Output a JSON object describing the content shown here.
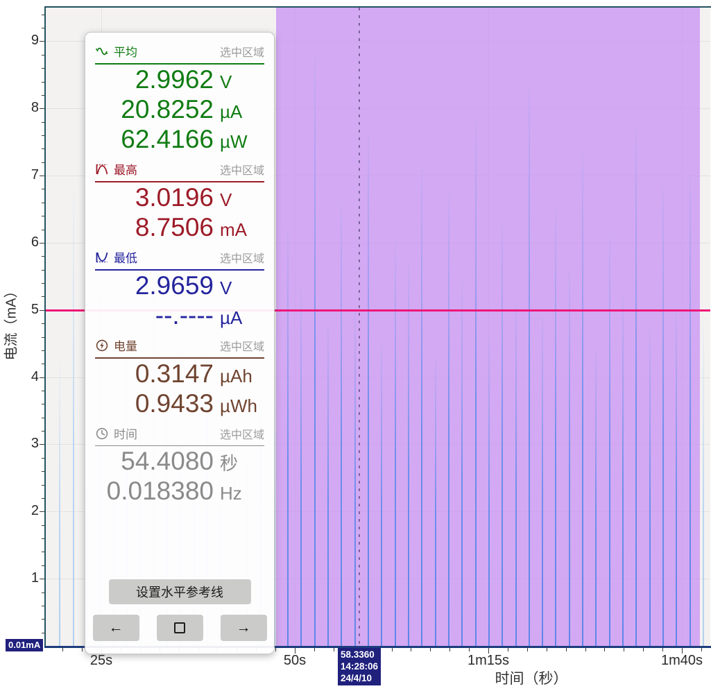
{
  "y_axis": {
    "title": "电流（mA）",
    "unit_marker": "0.01mA",
    "major_ticks": [
      1,
      2,
      3,
      4,
      5,
      6,
      7,
      8,
      9
    ]
  },
  "x_axis": {
    "title": "时间（秒）",
    "major_ticks": [
      {
        "t": 25,
        "label": "25s"
      },
      {
        "t": 50,
        "label": "50s"
      },
      {
        "t": 75,
        "label": "1m15s"
      },
      {
        "t": 100,
        "label": "1m40s"
      }
    ]
  },
  "cursor_badge": {
    "time": "58.3360",
    "clock": "14:28:06",
    "date": "24/4/10"
  },
  "panel": {
    "scope_label": "选中区域",
    "sections": [
      {
        "id": "average",
        "label": "平均",
        "icon": "wave-icon",
        "color": "#107c12",
        "rows": [
          {
            "value": "2.9962",
            "unit": "V"
          },
          {
            "value": "20.8252",
            "unit": "µA"
          },
          {
            "value": "62.4166",
            "unit": "µW"
          }
        ]
      },
      {
        "id": "maximum",
        "label": "最高",
        "icon": "peak-icon",
        "color": "#9c1b28",
        "rows": [
          {
            "value": "3.0196",
            "unit": "V"
          },
          {
            "value": "8.7506",
            "unit": "mA"
          }
        ]
      },
      {
        "id": "minimum",
        "label": "最低",
        "icon": "valley-icon",
        "color": "#24249c",
        "rows": [
          {
            "value": "2.9659",
            "unit": "V"
          },
          {
            "value": "--.----",
            "unit": "µA"
          }
        ]
      },
      {
        "id": "energy",
        "label": "电量",
        "icon": "energy-icon",
        "color": "#6f4430",
        "rows": [
          {
            "value": "0.3147",
            "unit": "µAh"
          },
          {
            "value": "0.9433",
            "unit": "µWh"
          }
        ]
      },
      {
        "id": "time",
        "label": "时间",
        "icon": "clock-icon",
        "color": "#8a8a8a",
        "rows": [
          {
            "value": "54.4080",
            "unit": "秒"
          },
          {
            "value": "0.018380",
            "unit": "Hz"
          }
        ]
      }
    ],
    "set_ref_button": "设置水平参考线",
    "nav_buttons": [
      {
        "id": "prev",
        "glyph": "←"
      },
      {
        "id": "stop",
        "glyph": "square"
      },
      {
        "id": "next",
        "glyph": "→"
      }
    ]
  },
  "colors": {
    "selection": "#d6b3f4",
    "spike_blue": "#6d8eec",
    "spike_light": "#aacdf2",
    "reference_pink": "#ee1677",
    "badge_navy": "#20207d",
    "border_teal": "#235261",
    "axis_navy": "#1d3c7e"
  },
  "chart_data": {
    "type": "line",
    "title": "",
    "xlabel": "时间（秒）",
    "ylabel": "电流（mA）",
    "x_range_s": [
      17.8,
      103.7
    ],
    "y_range_mA": [
      0,
      9.5
    ],
    "x_tick_labels": [
      "25s",
      "50s",
      "1m15s",
      "1m40s"
    ],
    "x_tick_values_s": [
      25,
      50,
      75,
      100
    ],
    "y_tick_values_mA": [
      1,
      2,
      3,
      4,
      5,
      6,
      7,
      8,
      9
    ],
    "minor_x_step_s": 2.5,
    "minor_y_step_mA": 0.2,
    "reference_line_mA": 5,
    "cursor_time_s": 58.336,
    "selection": {
      "start_s": 47.58,
      "end_s": 102.33
    },
    "spikes": {
      "start_s": 17.92,
      "period_s": 1.732,
      "peaks_mA": [
        5.6,
        4.2,
        6.8,
        5.1,
        7.4,
        4.6,
        6.1,
        5.5,
        7.9,
        4.9,
        6.4,
        5.2,
        8.1,
        4.4,
        6.9,
        5.8,
        7.2,
        4.7,
        6.2,
        5.3,
        8.75,
        4.8,
        6.6,
        5.0,
        7.6,
        4.5,
        6.0,
        5.7,
        7.1,
        4.3,
        6.7,
        5.4,
        7.8,
        4.6,
        6.3,
        5.1,
        8.3,
        4.9,
        6.5,
        5.6,
        7.3,
        4.4,
        6.1,
        5.2,
        7.7,
        4.7,
        6.8,
        5.0,
        7.0,
        4.8
      ]
    },
    "selected_region_stats": {
      "average": {
        "voltage_V": 2.9962,
        "current_uA": 20.8252,
        "power_uW": 62.4166
      },
      "maximum": {
        "voltage_V": 3.0196,
        "current_mA": 8.7506
      },
      "minimum": {
        "voltage_V": 2.9659,
        "current_uA": null
      },
      "energy": {
        "charge_uAh": 0.3147,
        "energy_uWh": 0.9433
      },
      "time": {
        "duration_s": 54.408,
        "frequency_Hz": 0.01838
      }
    }
  }
}
